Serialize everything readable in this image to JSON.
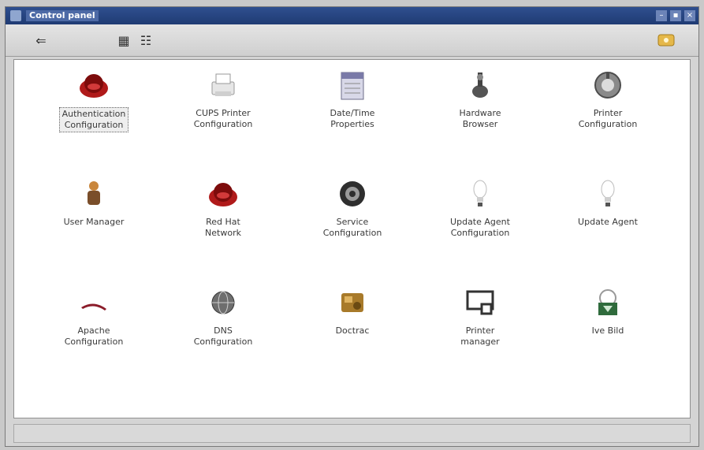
{
  "window": {
    "title": "Control panel",
    "controls": [
      "–",
      "▪",
      "×"
    ]
  },
  "toolbar": {
    "back_glyph": "⇐",
    "view_icons_glyph": "▦",
    "view_list_glyph": "☷"
  },
  "items": [
    {
      "label": "Authentication\nConfiguration",
      "icon": "redhat-icon",
      "selected": true
    },
    {
      "label": "CUPS Printer\nConfiguration",
      "icon": "printer-icon"
    },
    {
      "label": "Date/Time\nProperties",
      "icon": "calendar-icon"
    },
    {
      "label": "Hardware\nBrowser",
      "icon": "hardware-icon"
    },
    {
      "label": "Printer\nConfiguration",
      "icon": "printer-config-icon"
    },
    {
      "label": "User Manager",
      "icon": "user-icon"
    },
    {
      "label": "Red Hat\nNetwork",
      "icon": "redhat-network-icon"
    },
    {
      "label": "Service\nConfiguration",
      "icon": "gear-icon"
    },
    {
      "label": "Update Agent\nConfiguration",
      "icon": "bulb-icon"
    },
    {
      "label": "Update Agent",
      "icon": "bulb-icon"
    },
    {
      "label": "Apache\nConfiguration",
      "icon": "feather-icon"
    },
    {
      "label": "DNS\nConfiguration",
      "icon": "globe-icon"
    },
    {
      "label": "Doctrac",
      "icon": "box-icon"
    },
    {
      "label": "Printer\nmanager",
      "icon": "monitor-icon"
    },
    {
      "label": "Ive Bild",
      "icon": "network-icon"
    }
  ]
}
